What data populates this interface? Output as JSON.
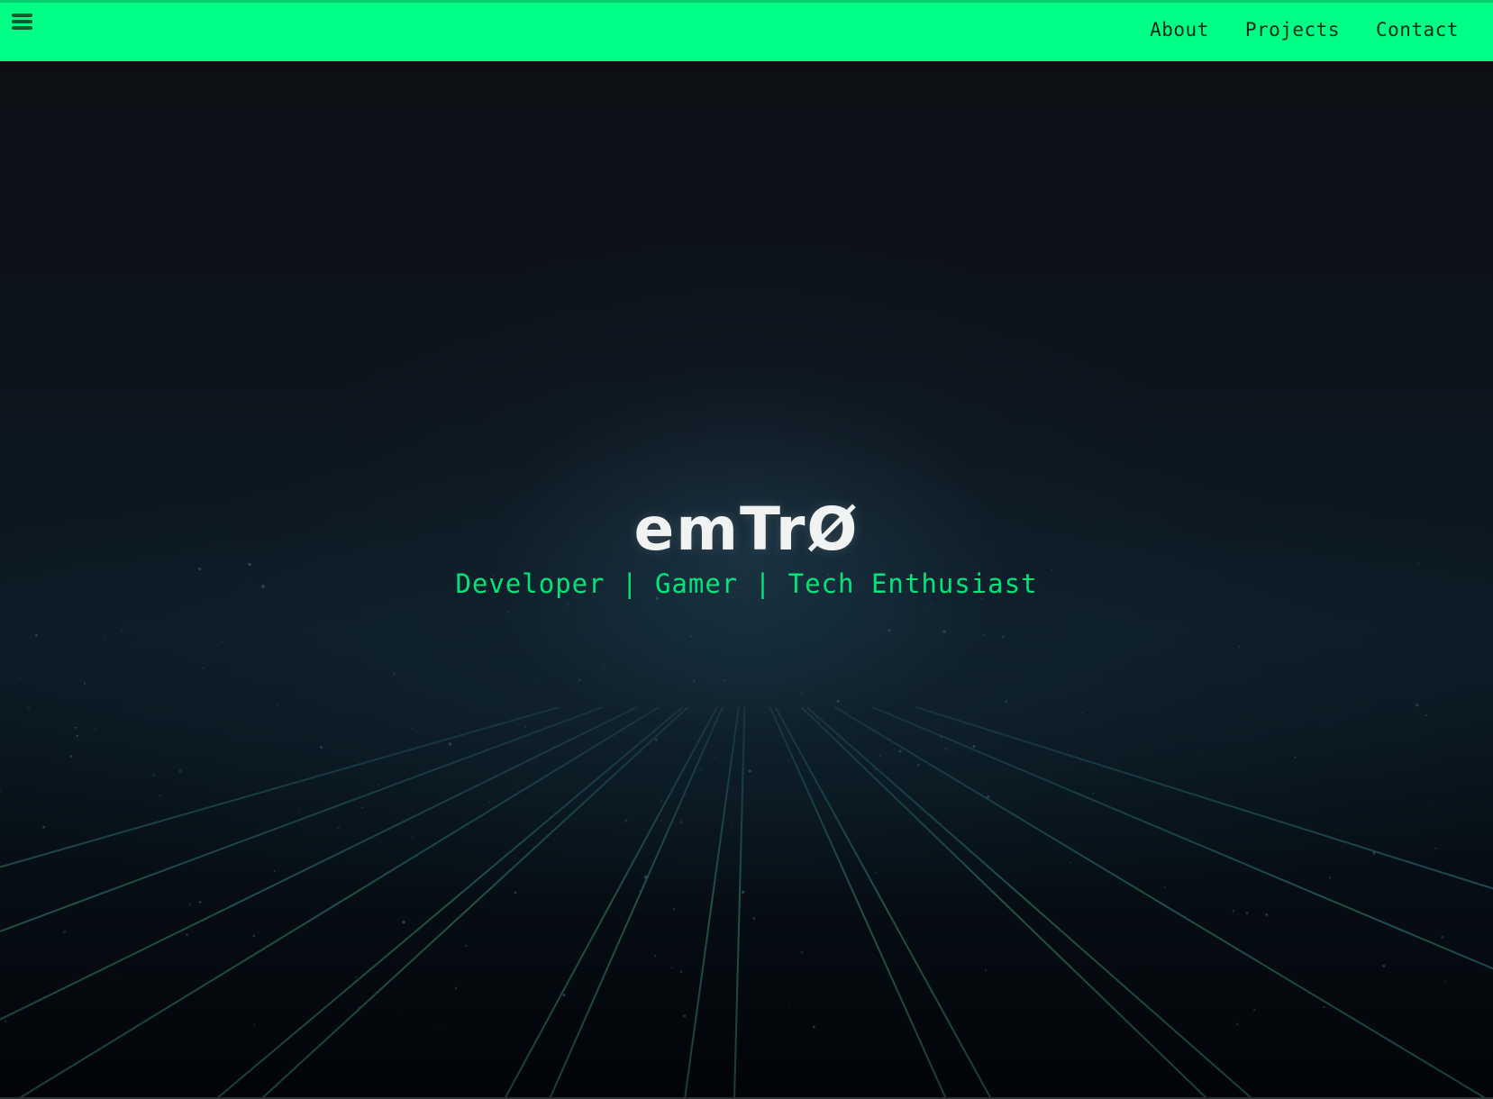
{
  "nav": {
    "menu_icon": "hamburger-menu-icon",
    "links": [
      {
        "label": "About"
      },
      {
        "label": "Projects"
      },
      {
        "label": "Contact"
      }
    ]
  },
  "hero": {
    "title": "emTrØ",
    "subtitle": "Developer | Gamer | Tech Enthusiast"
  },
  "colors": {
    "accent": "#00ff85",
    "subtitle": "#00e57a",
    "background": "#0a0c10",
    "grid": "#2b6b6f"
  }
}
